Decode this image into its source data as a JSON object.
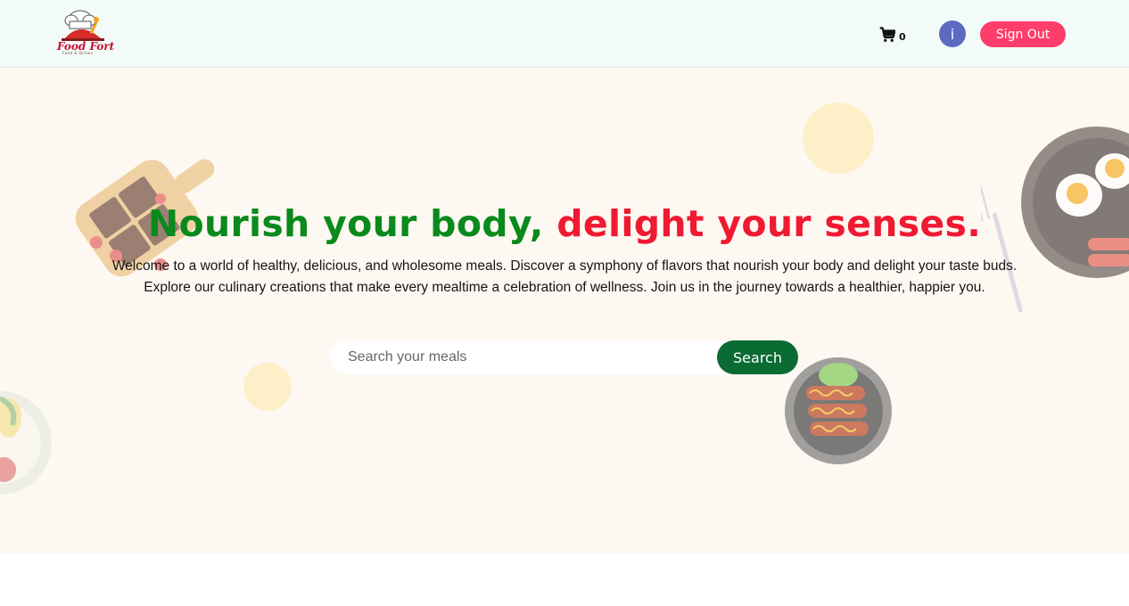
{
  "brand": {
    "name": "Food Fort",
    "tagline": "Food & Drinks"
  },
  "nav": {
    "cart_count": "0",
    "avatar_letter": "i",
    "signout_label": "Sign Out"
  },
  "hero": {
    "headline_part1": "Nourish your body,",
    "headline_part2": "delight your senses.",
    "description_line1": "Welcome to a world of healthy, delicious, and wholesome meals. Discover a symphony of flavors that nourish your body and delight your taste buds.",
    "description_line2": "Explore our culinary creations that make every mealtime a celebration of wellness. Join us in the journey towards a healthier, happier you."
  },
  "search": {
    "placeholder": "Search your meals",
    "button_label": "Search"
  },
  "colors": {
    "green": "#0a8a1c",
    "red": "#f01932",
    "signout": "#ff3d6a",
    "avatar": "#5c6bc0",
    "search_button": "#0a6b33",
    "hero_bg": "#fdf8f1",
    "nav_bg": "#f3fbf9"
  },
  "icons": {
    "cart": "shopping-cart-icon",
    "logo": "chef-hat-logo"
  }
}
